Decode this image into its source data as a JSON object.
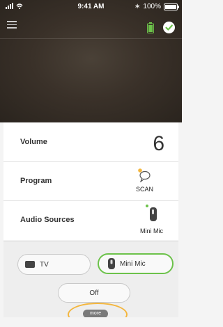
{
  "status_bar": {
    "carrier": "",
    "time": "9:41 AM",
    "battery": "100%"
  },
  "header": {
    "menu_icon": "hamburger-icon",
    "device_battery_icon": "battery-icon",
    "connected_icon": "check-circle-icon"
  },
  "rows": {
    "volume": {
      "label": "Volume",
      "value": "6"
    },
    "program": {
      "label": "Program",
      "value": "SCAN"
    },
    "audio_sources": {
      "label": "Audio Sources",
      "value": "Mini Mic"
    }
  },
  "sources": {
    "tv_label": "TV",
    "mini_mic_label": "Mini Mic",
    "off_label": "Off",
    "more_label": "more"
  },
  "colors": {
    "accent_green": "#6cc24a",
    "highlight_orange": "#f4b63d"
  }
}
